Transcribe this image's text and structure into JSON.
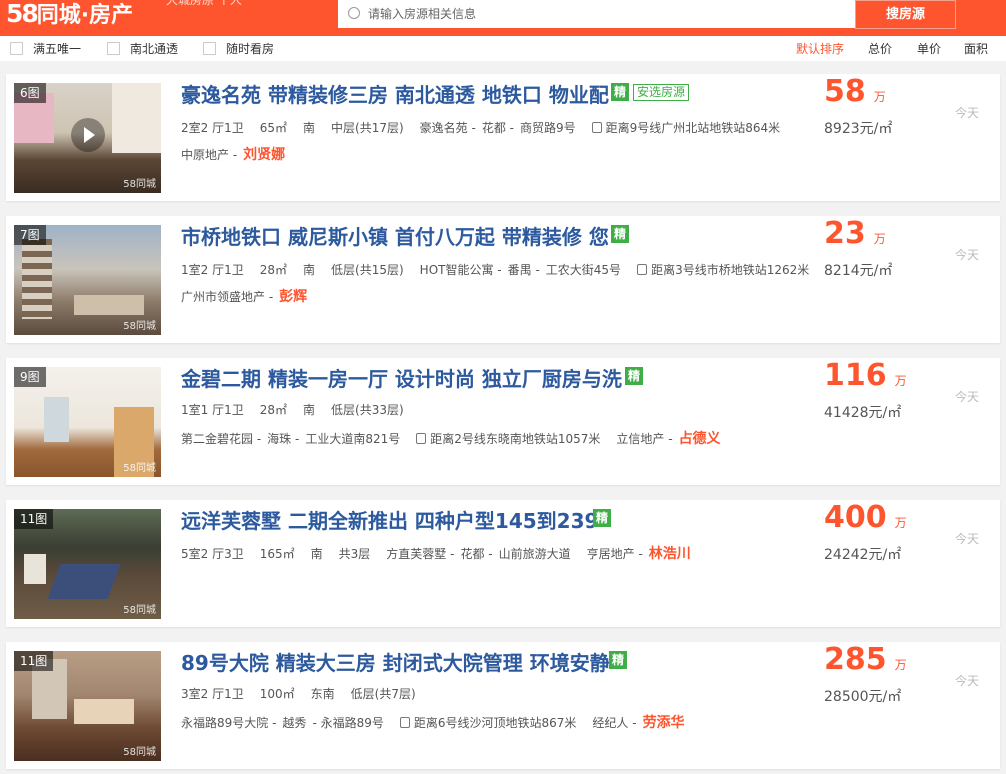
{
  "header": {
    "logo_num": "58",
    "logo_text": "同城·房产",
    "faded_tab": "大城房原  个人",
    "search_placeholder": "请输入房源相关信息",
    "search_button": "搜房源"
  },
  "filters": [
    "满五唯一",
    "南北通透",
    "随时看房"
  ],
  "sort": [
    "默认排序",
    "总价",
    "单价",
    "面积"
  ],
  "listings": [
    {
      "photos": "6图",
      "title": "豪逸名苑 带精装修三房 南北通透 地铁口 物业配",
      "tag": "精",
      "tag2": "安选房源",
      "layout": "2室2 厅1卫",
      "area": "65㎡",
      "orientation": "南",
      "floor": "中层(共17层)",
      "community": "豪逸名苑 -",
      "district": "花都 -",
      "road": "商贸路9号",
      "subway": "距离9号线广州北站地铁站864米",
      "agency": "中原地产 -",
      "agent": "刘贤娜",
      "price": "58",
      "price_unit": "万",
      "unit_price": "8923元/㎡",
      "time": "今天",
      "watermark": "58同城"
    },
    {
      "photos": "7图",
      "title": "市桥地铁口 威尼斯小镇 首付八万起 带精装修 您",
      "tag": "精",
      "layout": "1室2 厅1卫",
      "area": "28㎡",
      "orientation": "南",
      "floor": "低层(共15层)",
      "community": "HOT智能公寓 -",
      "district": "番禺 -",
      "road": "工农大街45号",
      "subway": "距离3号线市桥地铁站1262米",
      "agency": "广州市领盛地产 -",
      "agent": "彭辉",
      "price": "23",
      "price_unit": "万",
      "unit_price": "8214元/㎡",
      "time": "今天",
      "watermark": "58同城"
    },
    {
      "photos": "9图",
      "title": "金碧二期 精装一房一厅 设计时尚 独立厂厨房与洗",
      "tag": "精",
      "layout": "1室1 厅1卫",
      "area": "28㎡",
      "orientation": "南",
      "floor": "低层(共33层)",
      "community": "第二金碧花园 -",
      "district": "海珠 -",
      "road": "工业大道南821号",
      "subway": "距离2号线东晓南地铁站1057米",
      "agency": "立信地产 -",
      "agent": "占德义",
      "price": "116",
      "price_unit": "万",
      "unit_price": "41428元/㎡",
      "time": "今天",
      "watermark": "58同城"
    },
    {
      "photos": "11图",
      "title": "远洋芙蓉墅 二期全新推出 四种户型145到239",
      "tag": "精",
      "layout": "5室2 厅3卫",
      "area": "165㎡",
      "orientation": "南",
      "floor": "共3层",
      "community": "方直芙蓉墅 -",
      "district": "花都 -",
      "road": "山前旅游大道",
      "agency": "亨居地产 -",
      "agent": "林浩川",
      "price": "400",
      "price_unit": "万",
      "unit_price": "24242元/㎡",
      "time": "今天",
      "watermark": "58同城"
    },
    {
      "photos": "11图",
      "title": "89号大院 精装大三房 封闭式大院管理 环境安静",
      "tag": "精",
      "layout": "3室2 厅1卫",
      "area": "100㎡",
      "orientation": "东南",
      "floor": "低层(共7层)",
      "community": "永福路89号大院 -",
      "district": "越秀",
      "road": "- 永福路89号",
      "subway": "距离6号线沙河顶地铁站867米",
      "agency": "经纪人 -",
      "agent": "劳添华",
      "price": "285",
      "price_unit": "万",
      "unit_price": "28500元/㎡",
      "time": "今天",
      "watermark": "58同城"
    }
  ]
}
